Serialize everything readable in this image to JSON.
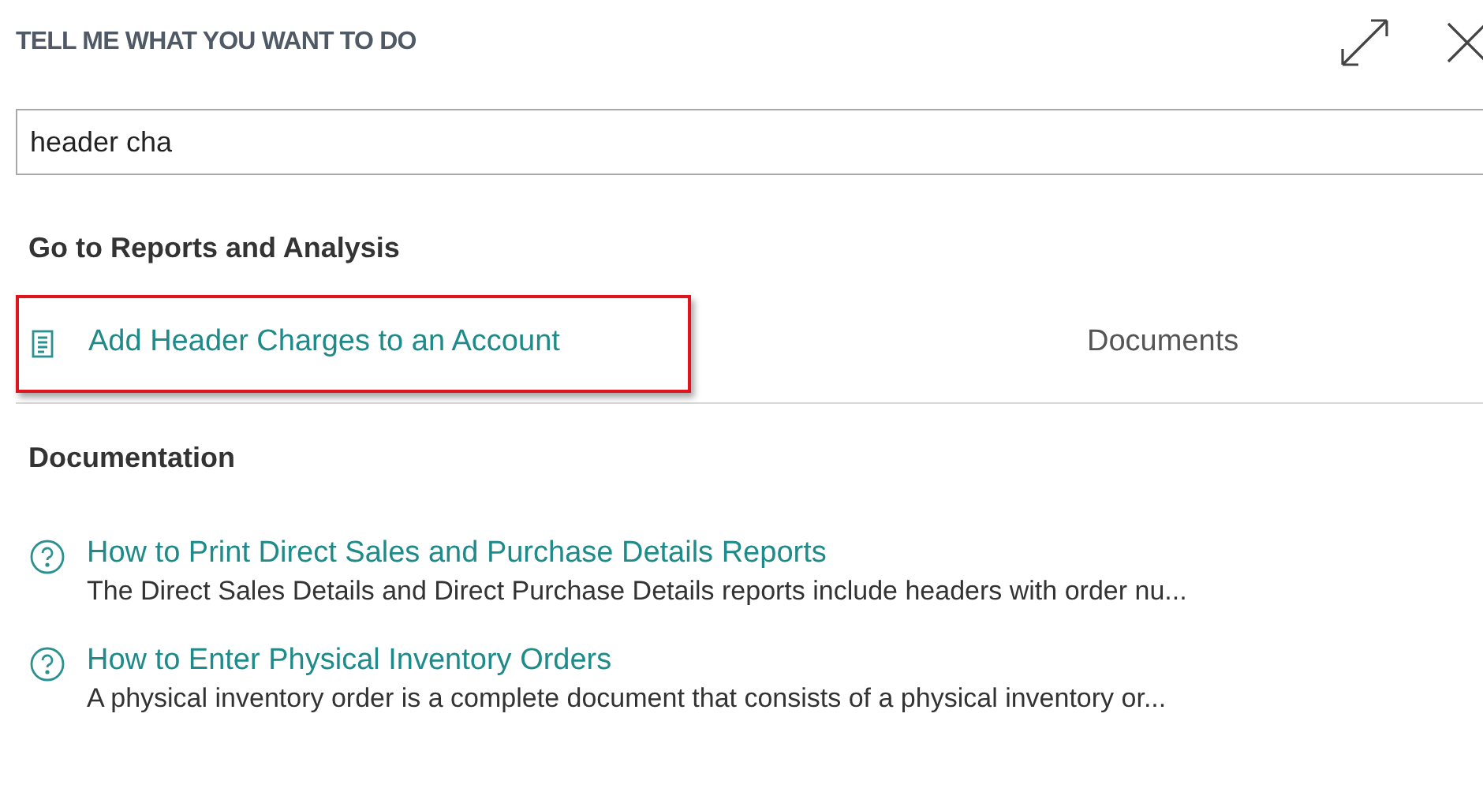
{
  "dialog": {
    "title": "TELL ME WHAT YOU WANT TO DO"
  },
  "search": {
    "value": "header cha"
  },
  "sections": [
    {
      "heading": "Go to Reports and Analysis",
      "kind": "results",
      "items": [
        {
          "label": "Add Header Charges to an Account",
          "category": "Documents",
          "highlighted": true
        }
      ]
    },
    {
      "heading": "Documentation",
      "kind": "docs",
      "items": [
        {
          "label": "How to Print Direct Sales and Purchase Details Reports",
          "description": "The Direct Sales Details and Direct Purchase Details reports include headers with order nu..."
        },
        {
          "label": "How to Enter Physical Inventory Orders",
          "description": "A physical inventory order is a complete document that consists of a physical inventory or..."
        }
      ]
    }
  ]
}
